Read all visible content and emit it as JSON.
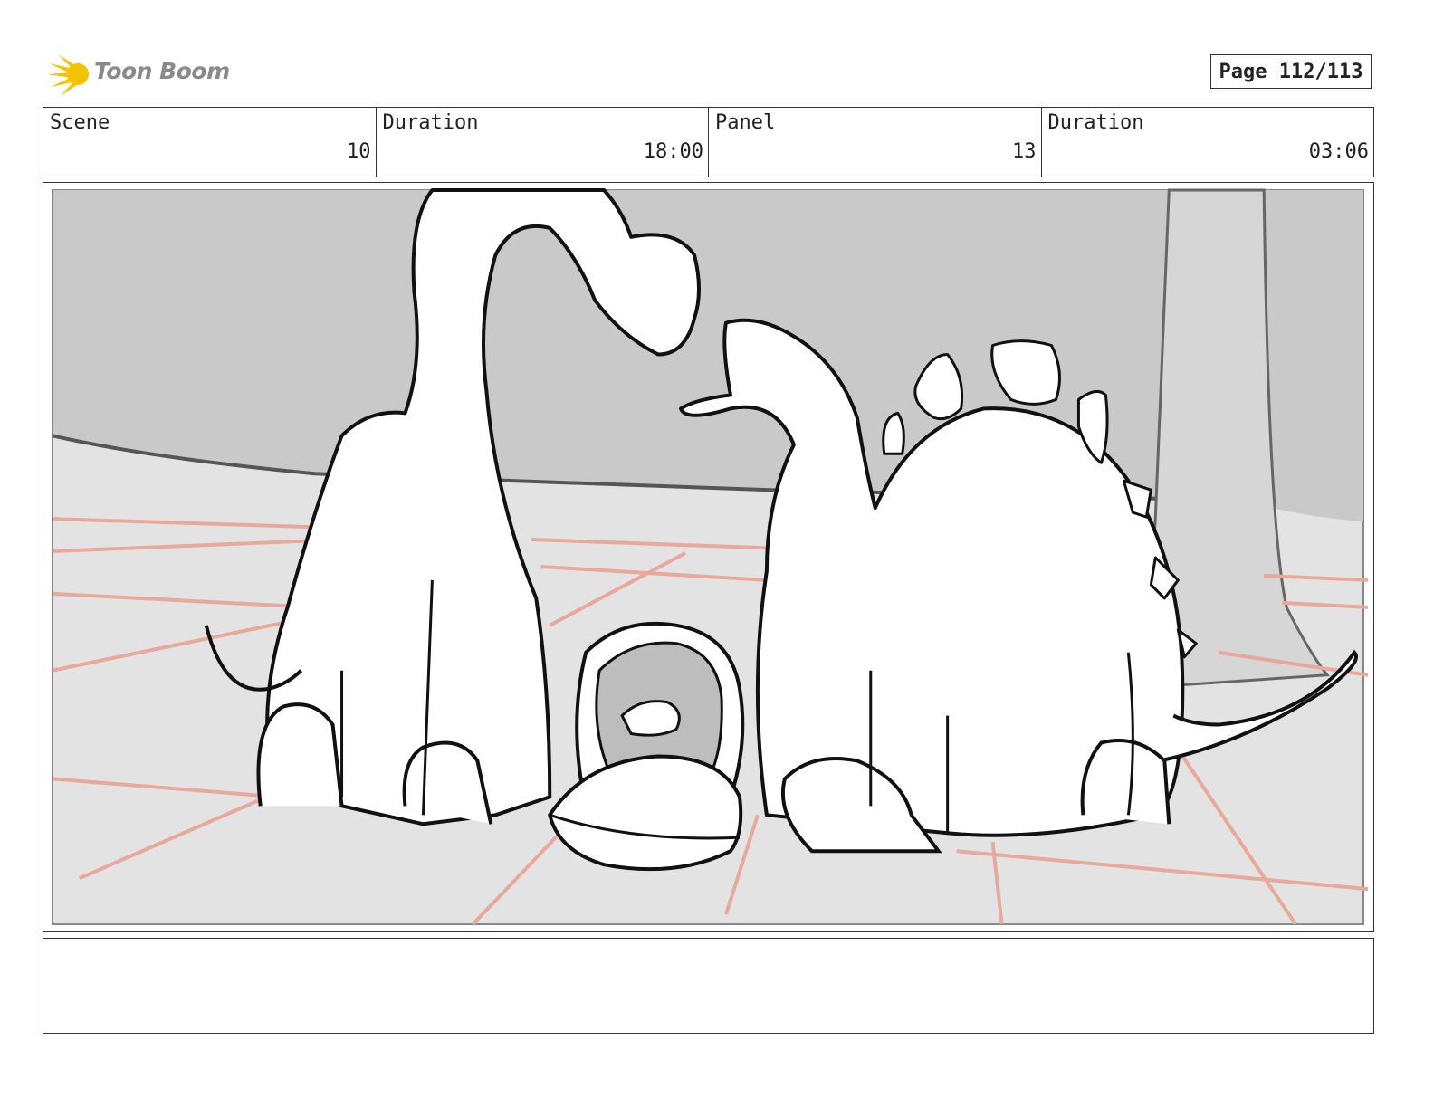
{
  "header": {
    "brand": "Toon Boom",
    "brand_icon": "starburst-logo-icon",
    "brand_color": "#f5c400",
    "page_label": "Page 112/113"
  },
  "info": {
    "scene_label": "Scene",
    "scene_value": "10",
    "scene_duration_label": "Duration",
    "scene_duration_value": "18:00",
    "panel_label": "Panel",
    "panel_value": "13",
    "panel_duration_label": "Duration",
    "panel_duration_value": "03:06"
  },
  "panel": {
    "sketch_colors": {
      "wall": "#c9c9c9",
      "floor": "#e3e3e3",
      "tile_lines": "#e8a89c",
      "ink": "#111111"
    }
  },
  "notes": {
    "text": ""
  }
}
